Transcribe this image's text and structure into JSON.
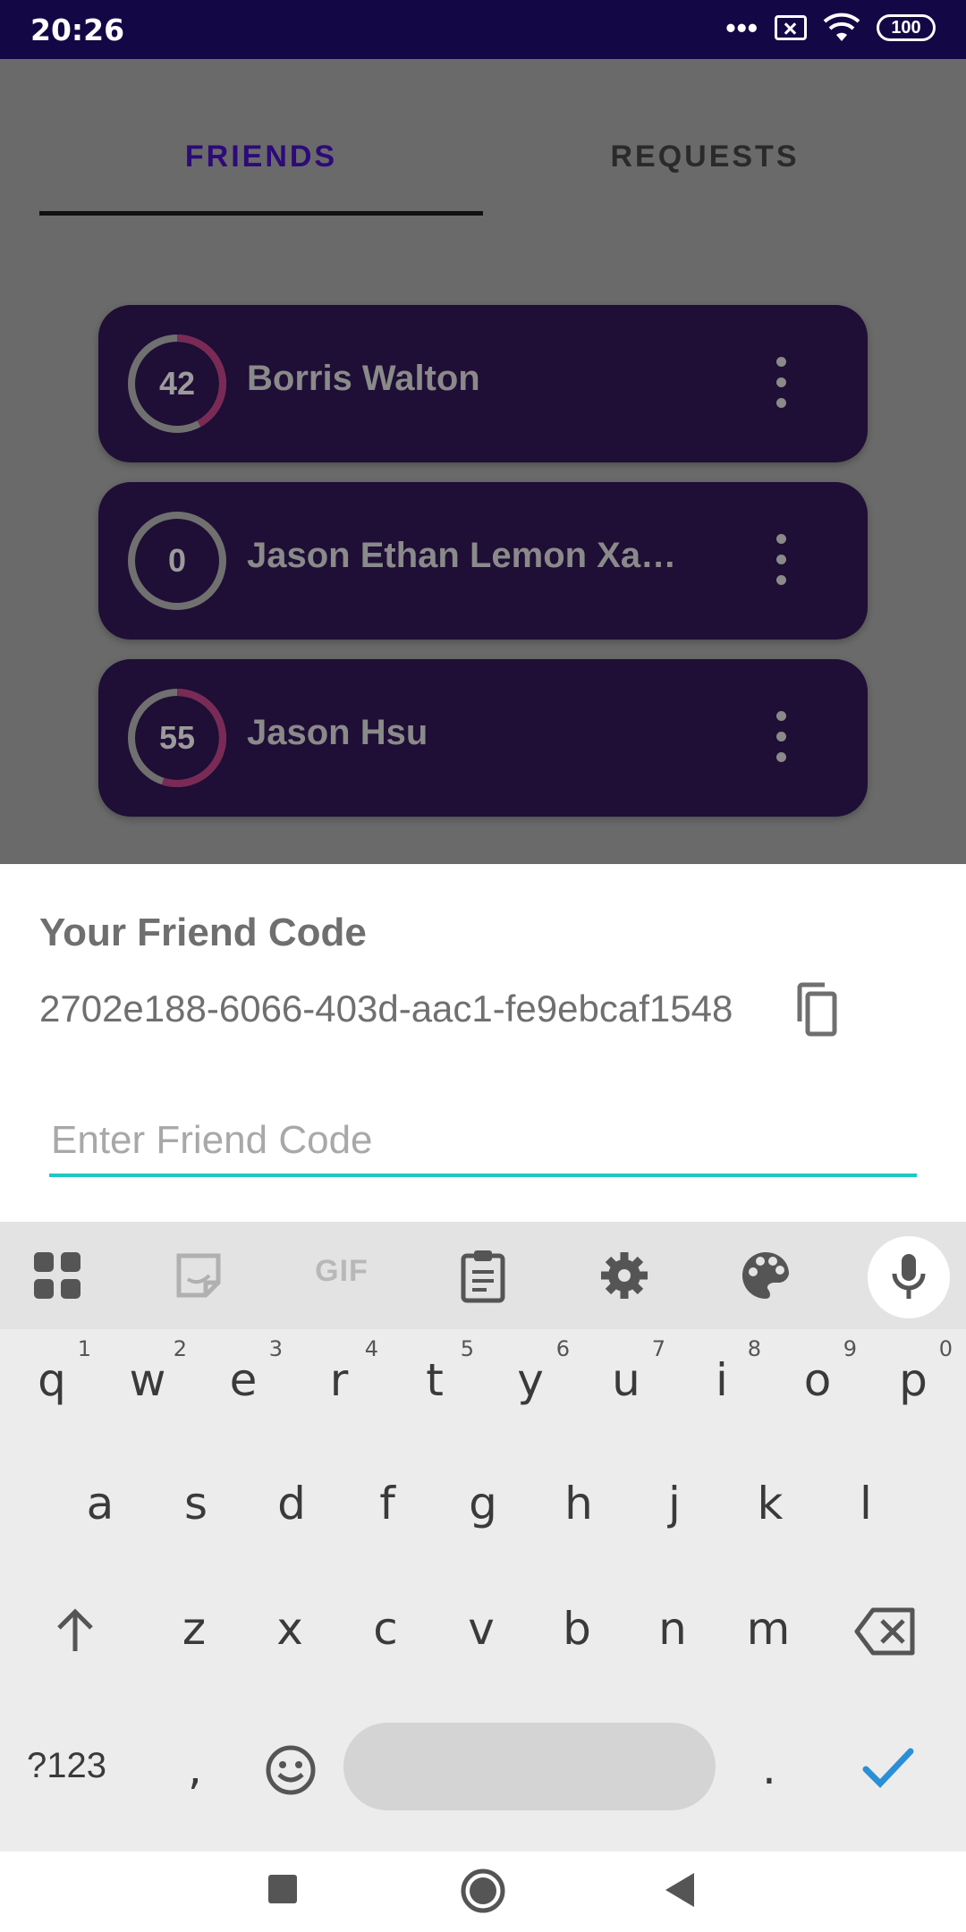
{
  "status_bar": {
    "time": "20:26",
    "battery": "100"
  },
  "tabs": [
    {
      "label": "FRIENDS",
      "active": true
    },
    {
      "label": "REQUESTS",
      "active": false
    }
  ],
  "friends": [
    {
      "score": "42",
      "progress": 0.42,
      "name": "Borris Walton"
    },
    {
      "score": "0",
      "progress": 0,
      "name": "Jason Ethan Lemon Xa…"
    },
    {
      "score": "55",
      "progress": 0.55,
      "name": "Jason Hsu"
    }
  ],
  "sheet": {
    "title": "Your Friend Code",
    "code": "2702e188-6066-403d-aac1-fe9ebcaf1548",
    "input_placeholder": "Enter Friend Code",
    "input_value": ""
  },
  "keyboard": {
    "toolbar": [
      "apps-icon",
      "sticker-icon",
      "gif-icon",
      "clipboard-icon",
      "settings-icon",
      "palette-icon",
      "mic-icon"
    ],
    "gif_label": "GIF",
    "row1": [
      {
        "ch": "q",
        "hint": "1"
      },
      {
        "ch": "w",
        "hint": "2"
      },
      {
        "ch": "e",
        "hint": "3"
      },
      {
        "ch": "r",
        "hint": "4"
      },
      {
        "ch": "t",
        "hint": "5"
      },
      {
        "ch": "y",
        "hint": "6"
      },
      {
        "ch": "u",
        "hint": "7"
      },
      {
        "ch": "i",
        "hint": "8"
      },
      {
        "ch": "o",
        "hint": "9"
      },
      {
        "ch": "p",
        "hint": "0"
      }
    ],
    "row2": [
      "a",
      "s",
      "d",
      "f",
      "g",
      "h",
      "j",
      "k",
      "l"
    ],
    "row3": [
      "z",
      "x",
      "c",
      "v",
      "b",
      "n",
      "m"
    ],
    "symbols_label": "?123",
    "comma": ",",
    "period": "."
  },
  "colors": {
    "statusbar": "#140746",
    "tab_active": "#2d0a78",
    "card": "#1f0e35",
    "ring_progress": "#7a2a55",
    "input_accent": "#1fc9c0",
    "enter_check": "#2b8fd6"
  }
}
